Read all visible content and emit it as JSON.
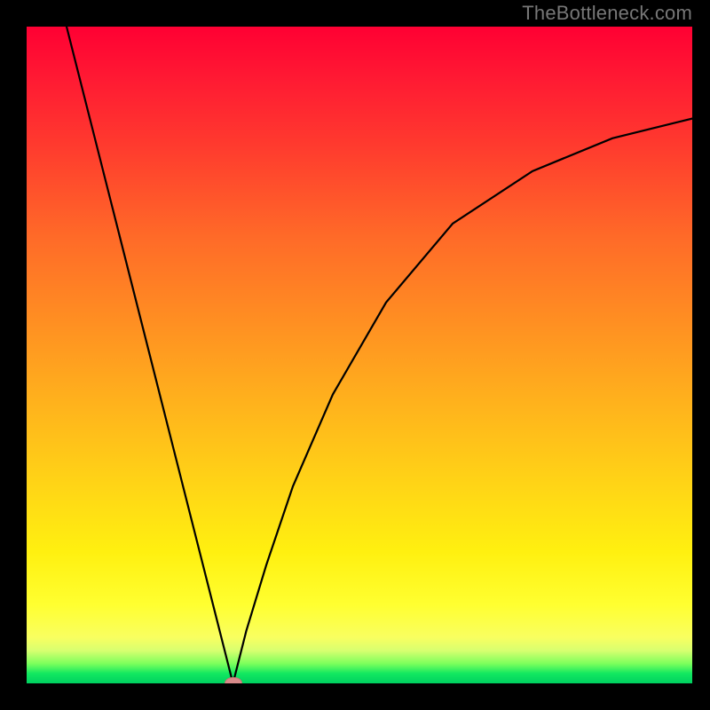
{
  "watermark": "TheBottleneck.com",
  "chart_data": {
    "type": "line",
    "title": "",
    "xlabel": "",
    "ylabel": "",
    "xlim": [
      0,
      100
    ],
    "ylim": [
      0,
      100
    ],
    "grid": false,
    "legend": false,
    "annotations": [
      {
        "type": "marker",
        "x": 31,
        "y": 0,
        "shape": "ellipse",
        "color": "#d88a8a"
      }
    ],
    "background_gradient": {
      "direction": "vertical",
      "stops": [
        {
          "pos": 0.0,
          "color": "#ff0033"
        },
        {
          "pos": 0.5,
          "color": "#ff9a20"
        },
        {
          "pos": 0.8,
          "color": "#fff010"
        },
        {
          "pos": 0.95,
          "color": "#d8ff70"
        },
        {
          "pos": 1.0,
          "color": "#00d060"
        }
      ]
    },
    "series": [
      {
        "name": "left-branch",
        "x": [
          6,
          10,
          14,
          18,
          22,
          26,
          28,
          30,
          31
        ],
        "y": [
          100,
          84,
          68,
          52,
          36,
          20,
          12,
          4,
          0
        ]
      },
      {
        "name": "right-branch",
        "x": [
          31,
          33,
          36,
          40,
          46,
          54,
          64,
          76,
          88,
          100
        ],
        "y": [
          0,
          8,
          18,
          30,
          44,
          58,
          70,
          78,
          83,
          86
        ]
      }
    ],
    "notes": "V-shaped curve with minimum at x≈31, y=0. Left branch is steep and near-linear from top-left; right branch rises and gradually levels off (sqrt-like) toward upper right. Values are approximate, read from pixel positions relative to plot extents."
  }
}
